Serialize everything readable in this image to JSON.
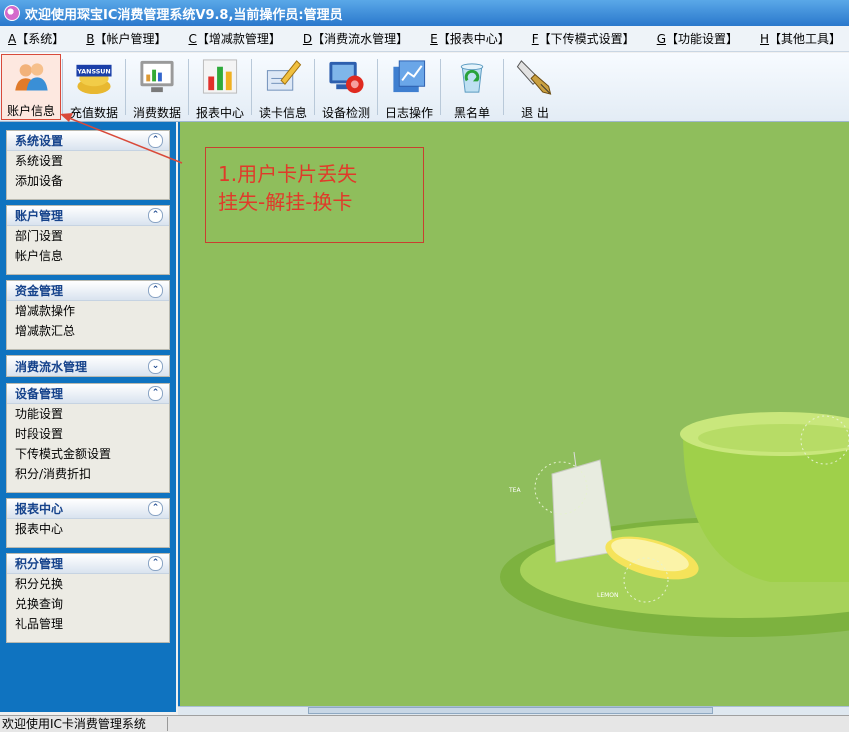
{
  "window": {
    "title": "欢迎使用琛宝IC消费管理系统V9.8,当前操作员:管理员"
  },
  "menu": [
    {
      "key": "A",
      "label": "【系统】"
    },
    {
      "key": "B",
      "label": "【帐户管理】"
    },
    {
      "key": "C",
      "label": "【增减款管理】"
    },
    {
      "key": "D",
      "label": "【消费流水管理】"
    },
    {
      "key": "E",
      "label": "【报表中心】"
    },
    {
      "key": "F",
      "label": "【下传模式设置】"
    },
    {
      "key": "G",
      "label": "【功能设置】"
    },
    {
      "key": "H",
      "label": "【其他工具】"
    }
  ],
  "toolbar": [
    {
      "label": "账户信息",
      "icon": "users-icon"
    },
    {
      "label": "充值数据",
      "icon": "gold-coins-icon",
      "badge": "YANSSUN"
    },
    {
      "label": "消费数据",
      "icon": "monitor-icon"
    },
    {
      "label": "报表中心",
      "icon": "bar-chart-icon"
    },
    {
      "label": "读卡信息",
      "icon": "pen-card-icon"
    },
    {
      "label": "设备检测",
      "icon": "device-check-icon"
    },
    {
      "label": "日志操作",
      "icon": "log-graph-icon"
    },
    {
      "label": "黑名单",
      "icon": "recycle-icon"
    },
    {
      "label": "退 出",
      "icon": "pen-nib-icon"
    }
  ],
  "sidebar": {
    "groups": [
      {
        "title": "系统设置",
        "chevron": "up",
        "items": [
          "系统设置",
          "添加设备"
        ]
      },
      {
        "title": "账户管理",
        "chevron": "up",
        "items": [
          "部门设置",
          "帐户信息"
        ]
      },
      {
        "title": "资金管理",
        "chevron": "up",
        "items": [
          "增减款操作",
          "增减款汇总"
        ]
      },
      {
        "title": "消费流水管理",
        "chevron": "down",
        "items": []
      },
      {
        "title": "设备管理",
        "chevron": "up",
        "items": [
          "功能设置",
          "时段设置",
          "下传模式金额设置",
          "积分/消费折扣"
        ]
      },
      {
        "title": "报表中心",
        "chevron": "up",
        "items": [
          "报表中心"
        ]
      },
      {
        "title": "积分管理",
        "chevron": "up",
        "items": [
          "积分兑换",
          "兑换查询",
          "礼品管理"
        ]
      }
    ]
  },
  "annotation": {
    "line1": "1.用户卡片丢失",
    "line2": "挂失-解挂-换卡",
    "color": "#e03a2a"
  },
  "background": {
    "tea_label": "TEA",
    "lemon_label": "LEMON",
    "color": "#8fbe5c"
  },
  "status": {
    "text": "欢迎使用IC卡消费管理系统"
  }
}
